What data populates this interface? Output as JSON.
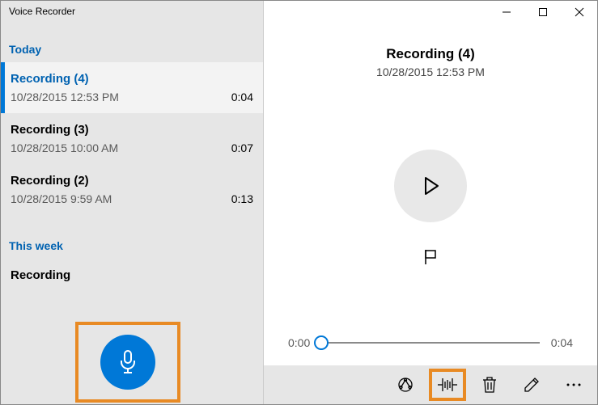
{
  "app_title": "Voice Recorder",
  "sections": {
    "today_label": "Today",
    "thisweek_label": "This week"
  },
  "recordings": {
    "today": [
      {
        "name": "Recording (4)",
        "timestamp": "10/28/2015 12:53 PM",
        "duration": "0:04",
        "selected": true
      },
      {
        "name": "Recording (3)",
        "timestamp": "10/28/2015 10:00 AM",
        "duration": "0:07",
        "selected": false
      },
      {
        "name": "Recording (2)",
        "timestamp": "10/28/2015 9:59 AM",
        "duration": "0:13",
        "selected": false
      }
    ],
    "thisweek": [
      {
        "name": "Recording",
        "timestamp": "",
        "duration": "",
        "selected": false
      }
    ]
  },
  "detail": {
    "title": "Recording (4)",
    "timestamp": "10/28/2015 12:53 PM",
    "position": "0:00",
    "duration": "0:04"
  },
  "commands": {
    "share": "Share",
    "trim": "Trim",
    "delete": "Delete",
    "rename": "Rename",
    "more": "More"
  },
  "colors": {
    "accent": "#0078d7",
    "highlight": "#e88a24"
  }
}
